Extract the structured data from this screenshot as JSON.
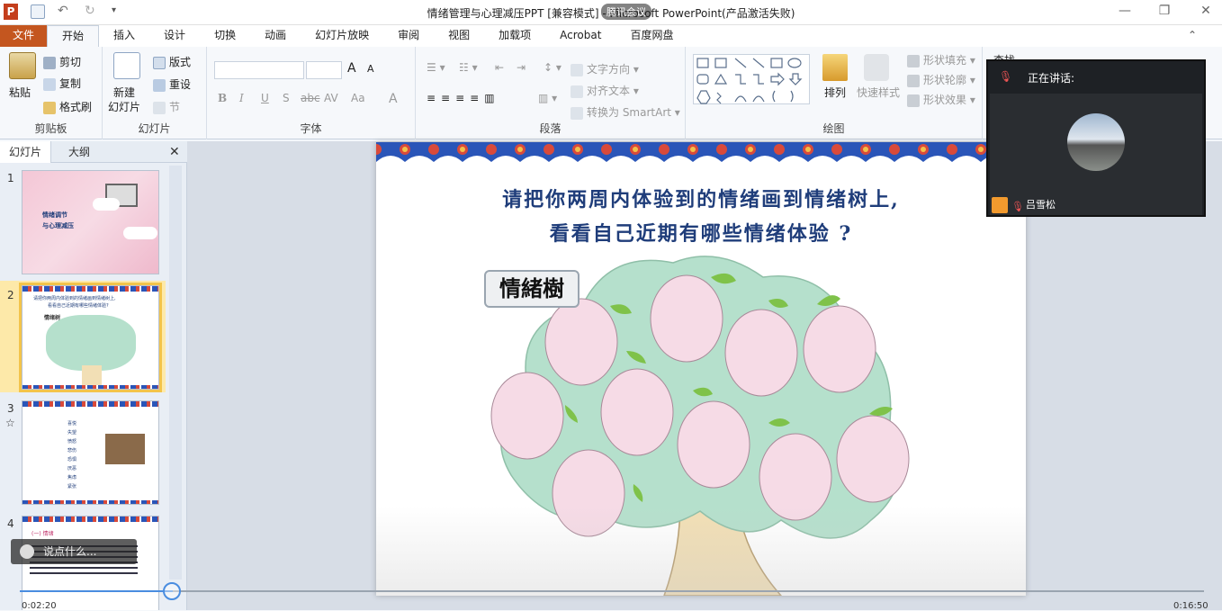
{
  "window": {
    "title": "情绪管理与心理减压PPT [兼容模式] - Microsoft PowerPoint(产品激活失败)",
    "app_icon": "P",
    "overlay_label": "腾讯会议",
    "controls": {
      "minimize": "—",
      "restore": "❐",
      "close": "✕"
    }
  },
  "tabs": [
    "文件",
    "开始",
    "插入",
    "设计",
    "切换",
    "动画",
    "幻灯片放映",
    "审阅",
    "视图",
    "加载项",
    "Acrobat",
    "百度网盘"
  ],
  "ribbon": {
    "clipboard": {
      "label": "剪贴板",
      "paste": "粘贴",
      "cut": "剪切",
      "copy": "复制",
      "format_painter": "格式刷"
    },
    "slides": {
      "label": "幻灯片",
      "new_slide_1": "新建",
      "new_slide_2": "幻灯片",
      "layout": "版式",
      "reset": "重设",
      "section": "节"
    },
    "font": {
      "label": "字体",
      "bold": "B",
      "italic": "I",
      "underline": "U",
      "shadow": "S",
      "strike": "abc",
      "spacing": "AV",
      "case": "Aa",
      "color": "A",
      "grow": "A",
      "shrink": "A"
    },
    "paragraph": {
      "label": "段落",
      "text_direction": "文字方向",
      "align_text": "对齐文本",
      "smartart": "转换为 SmartArt"
    },
    "drawing": {
      "label": "绘图",
      "arrange": "排列",
      "quick_styles": "快速样式",
      "shape_fill": "形状填充",
      "shape_outline": "形状轮廓",
      "shape_effects": "形状效果"
    },
    "editing": {
      "find": "查找"
    }
  },
  "pane": {
    "tabs": [
      "幻灯片",
      "大纲"
    ],
    "close": "✕",
    "slides": [
      {
        "num": "1",
        "title_line1": "情绪调节",
        "title_line2": "与心理减压"
      },
      {
        "num": "2",
        "title_line1": "请把你两周内体验到的情绪画到情绪树上,",
        "title_line2": "看看自己近期有哪些情绪体验?",
        "label": "情绪树"
      },
      {
        "num": "3",
        "star": "☆",
        "items": [
          "喜悦",
          "失望",
          "愤怒",
          "悲伤",
          "恐惧",
          "厌恶",
          "焦虑",
          "紧张"
        ]
      },
      {
        "num": "4",
        "line1": "(一) 情绪"
      }
    ]
  },
  "slide": {
    "line1": "请把你两周内体验到的情绪画到情绪树上,",
    "line2": "看看自己近期有哪些情绪体验 ?",
    "tree_label": "情緒樹"
  },
  "meeting": {
    "speaking": "正在讲话:",
    "user": "吕雪松"
  },
  "player": {
    "time_elapsed": "0:02:20",
    "time_total": "0:16:50",
    "chat_placeholder": "说点什么..."
  },
  "colors": {
    "file_tab": "#c4561f",
    "slide_title": "#1f3d7a",
    "leaf_green": "#7fc24a",
    "tree_green": "#b5e0cc",
    "fruit_pink": "#f6dbe6"
  }
}
